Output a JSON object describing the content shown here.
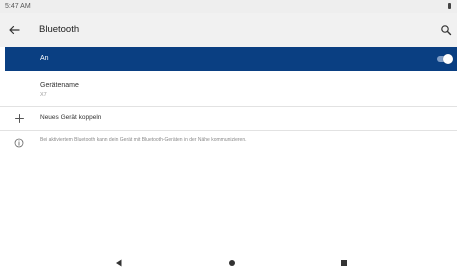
{
  "status_bar": {
    "time": "5:47 AM",
    "battery_icon": "battery-icon"
  },
  "app_bar": {
    "back_icon": "arrow-left-icon",
    "title": "Bluetooth",
    "search_icon": "search-icon"
  },
  "master_switch": {
    "label": "An",
    "state": "on",
    "color": "#0a3f82"
  },
  "device_name": {
    "label": "Gerätename",
    "value": "X7"
  },
  "pair_new": {
    "icon": "plus-icon",
    "label": "Neues Gerät koppeln"
  },
  "info": {
    "icon": "info-icon",
    "text": "Bei aktiviertem Bluetooth kann dein Gerät mit Bluetooth-Geräten in der Nähe kommunizieren."
  },
  "nav_bar": {
    "back_icon": "nav-back-triangle-icon",
    "home_icon": "nav-home-circle-icon",
    "recents_icon": "nav-recents-square-icon"
  }
}
